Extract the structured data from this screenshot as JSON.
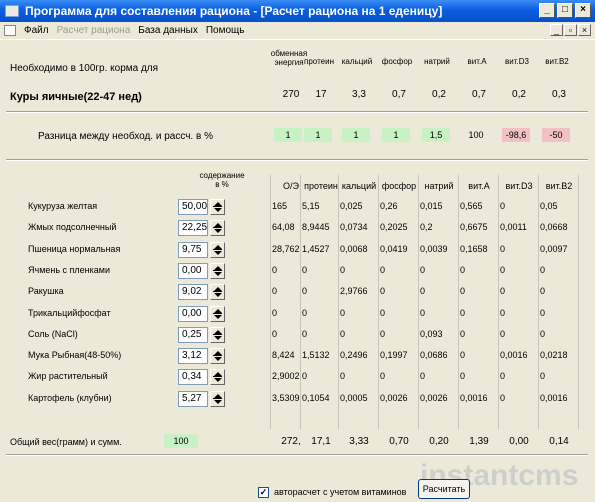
{
  "window": {
    "title": "Программа для составления рациона - [Расчет рациона на 1 еденицу]",
    "min": "_",
    "max": "□",
    "close": "×"
  },
  "menu": {
    "items": [
      "Файл",
      "Расчет рациона",
      "База данных",
      "Помощь"
    ],
    "mdi": [
      "_",
      "▫",
      "×"
    ]
  },
  "top": {
    "label": "Необходимо в 100гр. корма для",
    "headers": [
      "обменная энергия",
      "протеин",
      "кальций",
      "фосфор",
      "натрий",
      "вит.A",
      "вит.D3",
      "вит.B2"
    ],
    "animal": "Куры яичные(22-47 нед)",
    "values": [
      "270",
      "17",
      "3,3",
      "0,7",
      "0,2",
      "0,7",
      "0,2",
      "0,3"
    ]
  },
  "diff": {
    "label": "Разница между необход. и рассч. в %",
    "values": [
      "1",
      "1",
      "1",
      "1",
      "1,5",
      "100",
      "-98,6",
      "-50"
    ],
    "colors": [
      "green",
      "green",
      "green",
      "green",
      "green",
      "none",
      "pink",
      "pink"
    ]
  },
  "table": {
    "content_header": "содержание\nв %",
    "headers": [
      "О/Э",
      "протеин",
      "кальций",
      "фосфор",
      "натрий",
      "вит.A",
      "вит.D3",
      "вит.B2"
    ],
    "rows": [
      {
        "name": "Кукуруза желтая",
        "pct": "50,00",
        "vals": [
          "165",
          "5,15",
          "0,025",
          "0,26",
          "0,015",
          "0,565",
          "0",
          "0,05"
        ]
      },
      {
        "name": "Жмых подсолнечный",
        "pct": "22,25",
        "vals": [
          "64,08",
          "8,9445",
          "0,0734",
          "0,2025",
          "0,2",
          "0,6675",
          "0,0011",
          "0,0668"
        ]
      },
      {
        "name": "Пшеница нормальная",
        "pct": "9,75",
        "vals": [
          "28,762",
          "1,4527",
          "0,0068",
          "0,0419",
          "0,0039",
          "0,1658",
          "0",
          "0,0097"
        ]
      },
      {
        "name": "Ячмень с пленками",
        "pct": "0,00",
        "vals": [
          "0",
          "0",
          "0",
          "0",
          "0",
          "0",
          "0",
          "0"
        ]
      },
      {
        "name": "Ракушка",
        "pct": "9,02",
        "vals": [
          "0",
          "0",
          "2,9766",
          "0",
          "0",
          "0",
          "0",
          "0"
        ]
      },
      {
        "name": "Трикальцийфосфат",
        "pct": "0,00",
        "vals": [
          "0",
          "0",
          "0",
          "0",
          "0",
          "0",
          "0",
          "0"
        ]
      },
      {
        "name": "Соль (NaCl)",
        "pct": "0,25",
        "vals": [
          "0",
          "0",
          "0",
          "0",
          "0,093",
          "0",
          "0",
          "0"
        ]
      },
      {
        "name": "Мука Рыбная(48-50%)",
        "pct": "3,12",
        "vals": [
          "8,424",
          "1,5132",
          "0,2496",
          "0,1997",
          "0,0686",
          "0",
          "0,0016",
          "0,0218"
        ]
      },
      {
        "name": "Жир растительный",
        "pct": "0,34",
        "vals": [
          "2,9002",
          "0",
          "0",
          "0",
          "0",
          "0",
          "0",
          "0"
        ]
      },
      {
        "name": "Картофель (клубни)",
        "pct": "5,27",
        "vals": [
          "3,5309",
          "0,1054",
          "0,0005",
          "0,0026",
          "0,0026",
          "0,0016",
          "0",
          "0,0016"
        ]
      }
    ]
  },
  "total": {
    "label": "Общий вес(грамм) и сумм.",
    "weight": "100",
    "vals": [
      "272,",
      "17,1",
      "3,33",
      "0,70",
      "0,20",
      "1,39",
      "0,00",
      "0,14"
    ]
  },
  "footer": {
    "checkbox_label": "авторасчет с учетом витаминов",
    "checked": "✓",
    "button": "Расчитать"
  },
  "watermark": "instantcms"
}
